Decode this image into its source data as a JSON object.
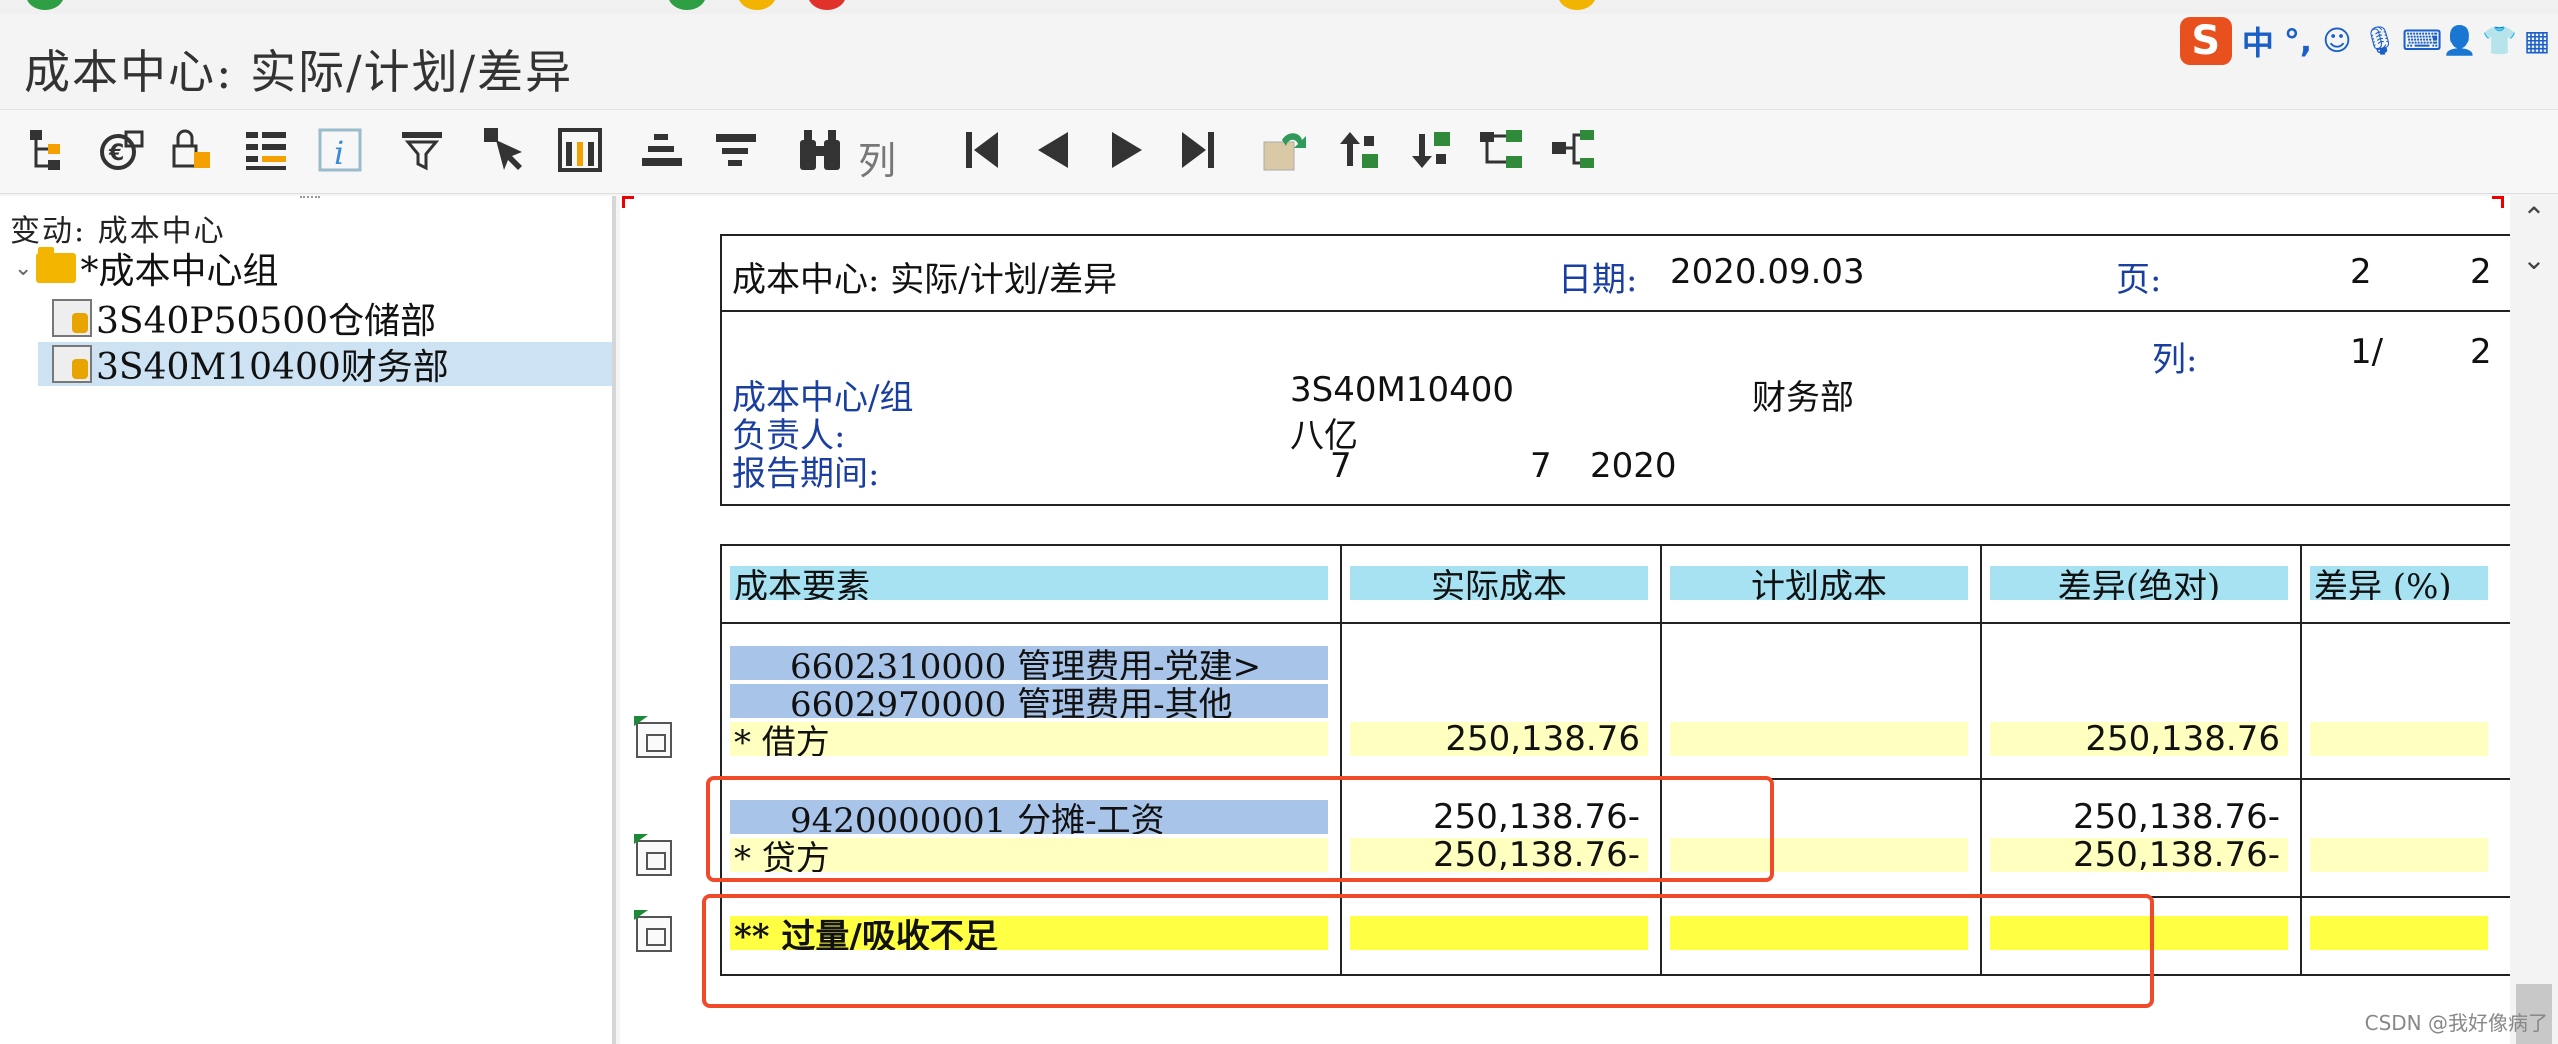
{
  "window": {
    "title": "成本中心: 实际/计划/差异"
  },
  "ime_bar": {
    "brand": "S",
    "mode": "中",
    "punct": "°,",
    "icons": [
      "smile-icon",
      "mic-icon",
      "keyboard-icon",
      "user-icon",
      "shirt-icon",
      "grid-icon"
    ]
  },
  "toolbar": {
    "column_label": "列",
    "icons": [
      "hierarchy-icon",
      "currency-icon",
      "lock-icon",
      "list-icon",
      "info-icon",
      "filter-icon",
      "select-cursor-icon",
      "layout-icon",
      "sort-asc-icon",
      "sort-desc-icon",
      "find-icon",
      "first-page-icon",
      "prev-page-icon",
      "next-page-icon",
      "last-page-icon",
      "export-icon",
      "expand-up-icon",
      "expand-down-icon",
      "tree-expand-icon",
      "tree-collapse-icon"
    ]
  },
  "sidebar": {
    "header": "变动: 成本中心",
    "root": "*成本中心组",
    "items": [
      {
        "label": "3S40P50500仓储部",
        "selected": false
      },
      {
        "label": "3S40M10400财务部",
        "selected": true
      }
    ]
  },
  "report": {
    "title": "成本中心: 实际/计划/差异",
    "date_label": "日期:",
    "date_value": "2020.09.03",
    "page_label": "页:",
    "page_current": "2",
    "page_total": "2",
    "col_label": "列:",
    "col_value": "1/",
    "col_total": "2",
    "center_label": "成本中心/组",
    "center_code": "3S40M10400",
    "center_name": "财务部",
    "owner_label": "负责人:",
    "owner_value": "八亿",
    "period_label": "报告期间:",
    "period_from": "7",
    "period_to": "7",
    "period_year": "2020"
  },
  "table": {
    "headers": [
      "成本要素",
      "实际成本",
      "计划成本",
      "差异(绝对)",
      "差异 (%)"
    ],
    "rows": {
      "r1_label": "6602310000  管理费用-党建>",
      "r2_label": "6602970000  管理费用-其他",
      "debit_label": "*  借方",
      "debit_actual": "250,138.76",
      "debit_diff": "250,138.76",
      "r3_label": "9420000001  分摊-工资",
      "r3_actual": "250,138.76-",
      "r3_diff": "250,138.76-",
      "credit_label": "*  贷方",
      "credit_actual": "250,138.76-",
      "credit_diff": "250,138.76-",
      "total_label": "** 过量/吸收不足"
    }
  },
  "watermark": "CSDN @我好像病了",
  "colors": {
    "header_cell": "#a6e2f1",
    "key_cell": "#a8c4e8",
    "light_yellow": "#ffffc0",
    "yellow": "#ffff44",
    "highlight_box": "#f04a2a"
  }
}
